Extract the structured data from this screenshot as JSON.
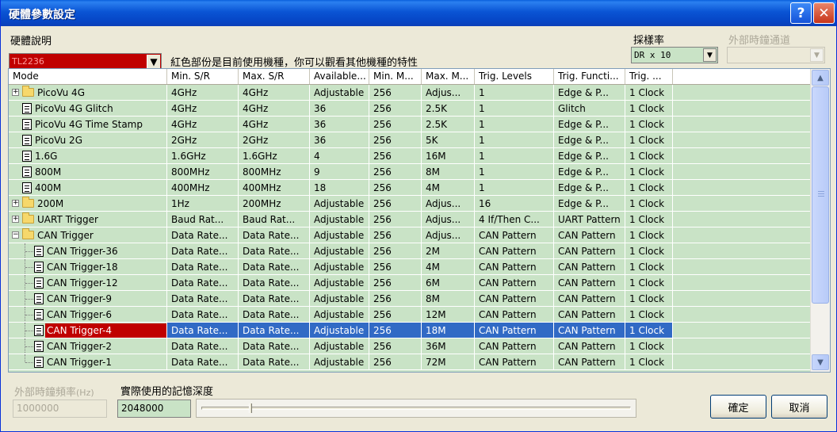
{
  "window": {
    "title": "硬體參數設定"
  },
  "titlebar_buttons": {
    "help": "?",
    "close": "✕"
  },
  "hardware": {
    "label": "硬體說明",
    "selected": "TL2236",
    "note": "紅色部份是目前使用機種，你可以觀看其他機種的特性"
  },
  "sample_rate": {
    "label": "採樣率",
    "value": "DR x 10"
  },
  "external_clock_channel": {
    "label": "外部時鐘通道",
    "value": ""
  },
  "table": {
    "columns": [
      "Mode",
      "Min. S/R",
      "Max. S/R",
      "Available...",
      "Min. M...",
      "Max. M...",
      "Trig. Levels",
      "Trig. Functi...",
      "Trig. ..."
    ],
    "rows": [
      {
        "indent": 0,
        "kind": "folder",
        "expander": "+",
        "cells": [
          "PicoVu 4G",
          "4GHz",
          "4GHz",
          "Adjustable",
          "256",
          "Adjus...",
          "1",
          "Edge & P...",
          "1 Clock"
        ]
      },
      {
        "indent": 0,
        "kind": "doc",
        "expander": "",
        "cells": [
          "PicoVu 4G Glitch",
          "4GHz",
          "4GHz",
          "36",
          "256",
          "2.5K",
          "1",
          "Glitch",
          "1 Clock"
        ]
      },
      {
        "indent": 0,
        "kind": "doc",
        "expander": "",
        "cells": [
          "PicoVu 4G Time Stamp",
          "4GHz",
          "4GHz",
          "36",
          "256",
          "2.5K",
          "1",
          "Edge & P...",
          "1 Clock"
        ]
      },
      {
        "indent": 0,
        "kind": "doc",
        "expander": "",
        "cells": [
          "PicoVu 2G",
          "2GHz",
          "2GHz",
          "36",
          "256",
          "5K",
          "1",
          "Edge & P...",
          "1 Clock"
        ]
      },
      {
        "indent": 0,
        "kind": "doc",
        "expander": "",
        "cells": [
          "1.6G",
          "1.6GHz",
          "1.6GHz",
          "4",
          "256",
          "16M",
          "1",
          "Edge & P...",
          "1 Clock"
        ]
      },
      {
        "indent": 0,
        "kind": "doc",
        "expander": "",
        "cells": [
          "800M",
          "800MHz",
          "800MHz",
          "9",
          "256",
          "8M",
          "1",
          "Edge & P...",
          "1 Clock"
        ]
      },
      {
        "indent": 0,
        "kind": "doc",
        "expander": "",
        "cells": [
          "400M",
          "400MHz",
          "400MHz",
          "18",
          "256",
          "4M",
          "1",
          "Edge & P...",
          "1 Clock"
        ]
      },
      {
        "indent": 0,
        "kind": "folder",
        "expander": "+",
        "cells": [
          "200M",
          "1Hz",
          "200MHz",
          "Adjustable",
          "256",
          "Adjus...",
          "16",
          "Edge & P...",
          "1 Clock"
        ]
      },
      {
        "indent": 0,
        "kind": "folder",
        "expander": "+",
        "cells": [
          "UART Trigger",
          "Baud Rat...",
          "Baud Rat...",
          "Adjustable",
          "256",
          "Adjus...",
          "4 If/Then C...",
          "UART Pattern",
          "1 Clock"
        ]
      },
      {
        "indent": 0,
        "kind": "folder",
        "expander": "−",
        "cells": [
          "CAN Trigger",
          "Data Rate...",
          "Data Rate...",
          "Adjustable",
          "256",
          "Adjus...",
          "CAN Pattern",
          "CAN Pattern",
          "1 Clock"
        ]
      },
      {
        "indent": 1,
        "kind": "doc",
        "expander": "",
        "cells": [
          "CAN Trigger-36",
          "Data Rate...",
          "Data Rate...",
          "Adjustable",
          "256",
          "2M",
          "CAN Pattern",
          "CAN Pattern",
          "1 Clock"
        ]
      },
      {
        "indent": 1,
        "kind": "doc",
        "expander": "",
        "cells": [
          "CAN Trigger-18",
          "Data Rate...",
          "Data Rate...",
          "Adjustable",
          "256",
          "4M",
          "CAN Pattern",
          "CAN Pattern",
          "1 Clock"
        ]
      },
      {
        "indent": 1,
        "kind": "doc",
        "expander": "",
        "cells": [
          "CAN Trigger-12",
          "Data Rate...",
          "Data Rate...",
          "Adjustable",
          "256",
          "6M",
          "CAN Pattern",
          "CAN Pattern",
          "1 Clock"
        ]
      },
      {
        "indent": 1,
        "kind": "doc",
        "expander": "",
        "cells": [
          "CAN Trigger-9",
          "Data Rate...",
          "Data Rate...",
          "Adjustable",
          "256",
          "8M",
          "CAN Pattern",
          "CAN Pattern",
          "1 Clock"
        ]
      },
      {
        "indent": 1,
        "kind": "doc",
        "expander": "",
        "cells": [
          "CAN Trigger-6",
          "Data Rate...",
          "Data Rate...",
          "Adjustable",
          "256",
          "12M",
          "CAN Pattern",
          "CAN Pattern",
          "1 Clock"
        ]
      },
      {
        "indent": 1,
        "kind": "doc",
        "expander": "",
        "selected": true,
        "cells": [
          "CAN Trigger-4",
          "Data Rate...",
          "Data Rate...",
          "Adjustable",
          "256",
          "18M",
          "CAN Pattern",
          "CAN Pattern",
          "1 Clock"
        ]
      },
      {
        "indent": 1,
        "kind": "doc",
        "expander": "",
        "cells": [
          "CAN Trigger-2",
          "Data Rate...",
          "Data Rate...",
          "Adjustable",
          "256",
          "36M",
          "CAN Pattern",
          "CAN Pattern",
          "1 Clock"
        ]
      },
      {
        "indent": 1,
        "kind": "doc",
        "expander": "",
        "cells": [
          "CAN Trigger-1",
          "Data Rate...",
          "Data Rate...",
          "Adjustable",
          "256",
          "72M",
          "CAN Pattern",
          "CAN Pattern",
          "1 Clock"
        ]
      }
    ]
  },
  "external_clock_freq": {
    "label": "外部時鐘頻率",
    "unit": "(Hz)",
    "value": "1000000"
  },
  "memory_depth": {
    "label": "實際使用的記憶深度",
    "value": "2048000"
  },
  "buttons": {
    "ok": "確定",
    "cancel": "取消"
  },
  "colors": {
    "grid_bg": "#c9e3c6",
    "selected_bg": "#316ac5",
    "current_model": "#c00000"
  }
}
